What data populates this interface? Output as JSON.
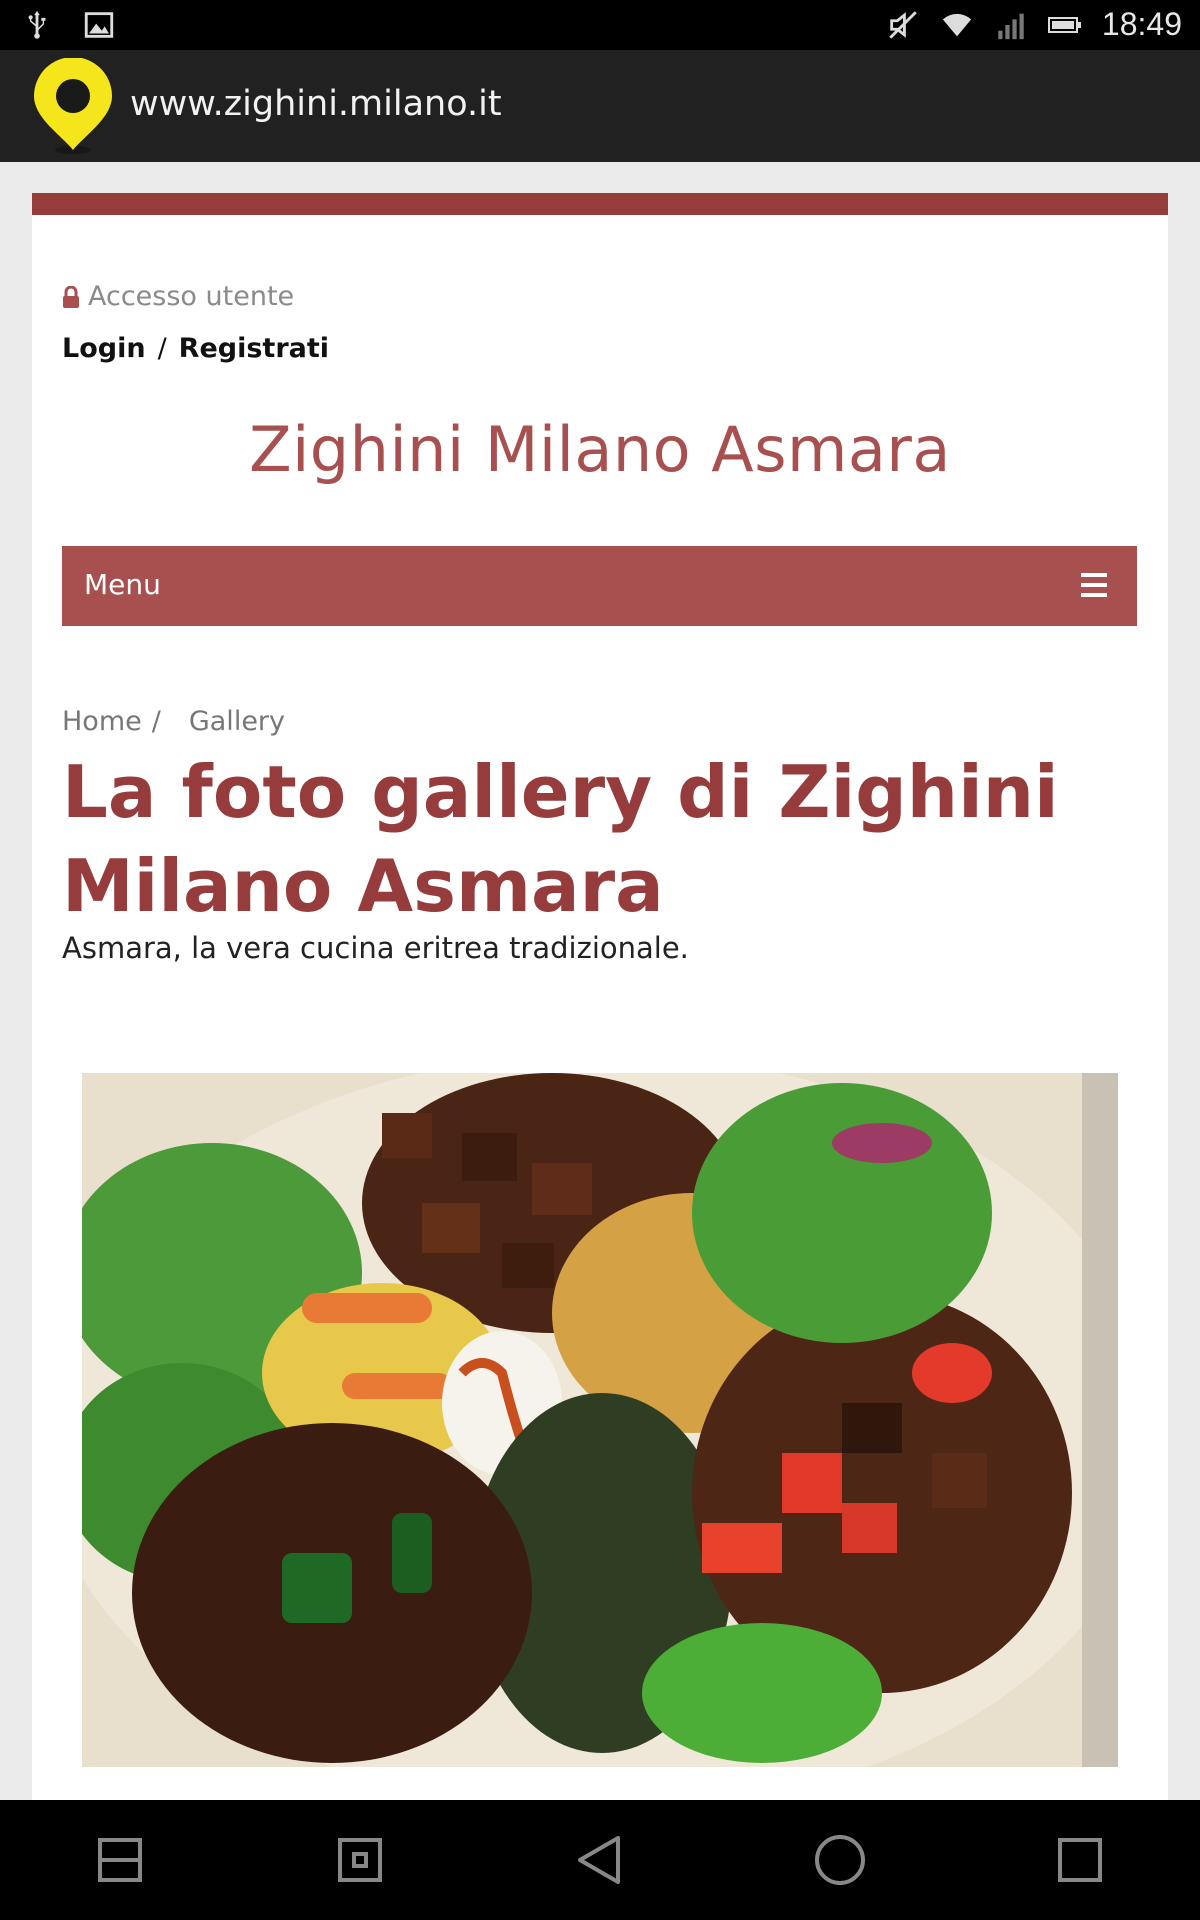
{
  "status_bar": {
    "time": "18:49",
    "icons_left": [
      "usb-icon",
      "image-notification-icon"
    ],
    "icons_right": [
      "mute-icon",
      "wifi-icon",
      "signal-icon",
      "battery-icon"
    ]
  },
  "app_bar": {
    "url": "www.zighini.milano.it",
    "logo_icon": "map-pin-logo-icon",
    "logo_color": "#f5e51b"
  },
  "header": {
    "user_access_label": "Accesso utente",
    "login_label": "Login",
    "login_separator": "/",
    "register_label": "Registrati",
    "site_title": "Zighini Milano Asmara"
  },
  "menu": {
    "label": "Menu",
    "icon": "hamburger-icon"
  },
  "breadcrumb": {
    "home": "Home",
    "separator": "/",
    "current": "Gallery"
  },
  "content": {
    "heading": "La foto gallery di Zighini Milano Asmara",
    "subtitle": "Asmara, la vera cucina eritrea tradizionale."
  },
  "colors": {
    "brand_red": "#a85050",
    "heading_red": "#963c3c",
    "band_red": "#963c3c"
  },
  "nav_bar": {
    "buttons": [
      "split-screen-icon",
      "screenshot-icon",
      "back-icon",
      "home-icon",
      "recents-icon"
    ]
  }
}
